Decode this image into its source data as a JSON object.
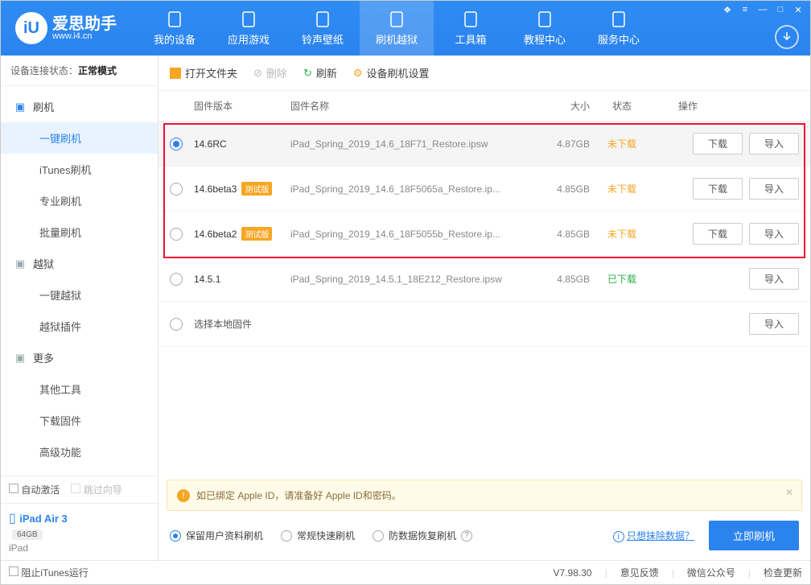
{
  "app": {
    "name": "爱思助手",
    "url": "www.i4.cn"
  },
  "nav": [
    {
      "label": "我的设备"
    },
    {
      "label": "应用游戏"
    },
    {
      "label": "铃声壁纸"
    },
    {
      "label": "刷机越狱",
      "active": true
    },
    {
      "label": "工具箱"
    },
    {
      "label": "教程中心"
    },
    {
      "label": "服务中心"
    }
  ],
  "status": {
    "label": "设备连接状态：",
    "value": "正常模式"
  },
  "sidebar": {
    "groups": [
      {
        "title": "刷机",
        "icon": "flash",
        "items": [
          {
            "label": "一键刷机",
            "active": true
          },
          {
            "label": "iTunes刷机"
          },
          {
            "label": "专业刷机"
          },
          {
            "label": "批量刷机"
          }
        ]
      },
      {
        "title": "越狱",
        "icon": "shield",
        "items": [
          {
            "label": "一键越狱"
          },
          {
            "label": "越狱插件"
          }
        ]
      },
      {
        "title": "更多",
        "icon": "more",
        "items": [
          {
            "label": "其他工具"
          },
          {
            "label": "下载固件"
          },
          {
            "label": "高级功能"
          }
        ]
      }
    ],
    "foot": {
      "auto": "自动激活",
      "skip": "跳过向导"
    },
    "device": {
      "name": "iPad Air 3",
      "storage": "64GB",
      "model": "iPad"
    }
  },
  "toolbar": {
    "open": "打开文件夹",
    "delete": "删除",
    "refresh": "刷新",
    "settings": "设备刷机设置"
  },
  "table": {
    "head": {
      "version": "固件版本",
      "name": "固件名称",
      "size": "大小",
      "status": "状态",
      "ops": "操作"
    },
    "btn": {
      "download": "下载",
      "import": "导入"
    },
    "status_text": {
      "not": "未下载",
      "done": "已下载"
    },
    "rows": [
      {
        "version": "14.6RC",
        "badge": "",
        "name": "iPad_Spring_2019_14.6_18F71_Restore.ipsw",
        "size": "4.87GB",
        "status": "not",
        "selected": true,
        "highlight": true
      },
      {
        "version": "14.6beta3",
        "badge": "测试版",
        "name": "iPad_Spring_2019_14.6_18F5065a_Restore.ip...",
        "size": "4.85GB",
        "status": "not",
        "highlight": true
      },
      {
        "version": "14.6beta2",
        "badge": "测试版",
        "name": "iPad_Spring_2019_14.6_18F5055b_Restore.ip...",
        "size": "4.85GB",
        "status": "not",
        "highlight": true
      },
      {
        "version": "14.5.1",
        "badge": "",
        "name": "iPad_Spring_2019_14.5.1_18E212_Restore.ipsw",
        "size": "4.85GB",
        "status": "done"
      }
    ],
    "local": "选择本地固件"
  },
  "warn": "如已绑定 Apple ID，请准备好 Apple ID和密码。",
  "modes": {
    "items": [
      {
        "label": "保留用户资料刷机",
        "on": true
      },
      {
        "label": "常规快速刷机"
      },
      {
        "label": "防数据恢复刷机",
        "help": true
      }
    ],
    "erase": "只想抹除数据？",
    "flash": "立即刷机"
  },
  "footer": {
    "block": "阻止iTunes运行",
    "version": "V7.98.30",
    "feedback": "意见反馈",
    "wechat": "微信公众号",
    "update": "检查更新"
  }
}
